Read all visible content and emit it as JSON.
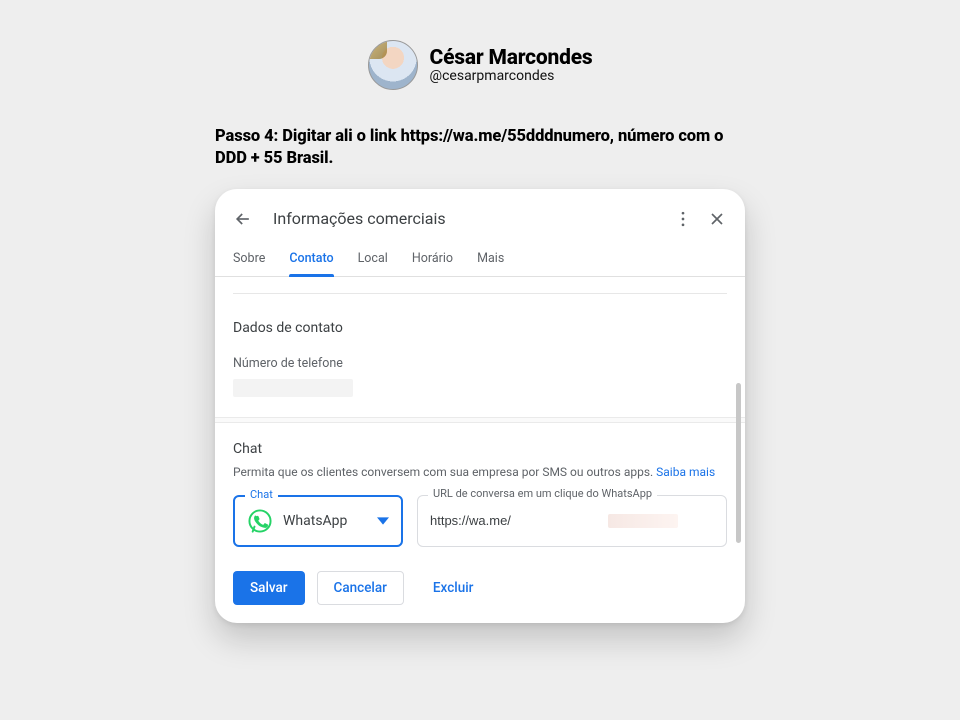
{
  "author": {
    "name": "César Marcondes",
    "handle": "@cesarpmarcondes"
  },
  "instruction": "Passo 4:  Digitar ali o link https://wa.me/55dddnumero, número com o DDD + 55 Brasil.",
  "card": {
    "title": "Informações comerciais",
    "tabs": {
      "sobre": "Sobre",
      "contato": "Contato",
      "local": "Local",
      "horario": "Horário",
      "mais": "Mais"
    },
    "contact": {
      "section_title": "Dados de contato",
      "phone_label": "Número de telefone"
    },
    "chat": {
      "title": "Chat",
      "description": "Permita que os clientes conversem com sua empresa por SMS ou outros apps. ",
      "learn_more": "Saiba mais",
      "select_label": "Chat",
      "select_value": "WhatsApp",
      "url_label": "URL de conversa em um clique do WhatsApp",
      "url_value": "https://wa.me/"
    },
    "actions": {
      "save": "Salvar",
      "cancel": "Cancelar",
      "delete": "Excluir"
    }
  }
}
